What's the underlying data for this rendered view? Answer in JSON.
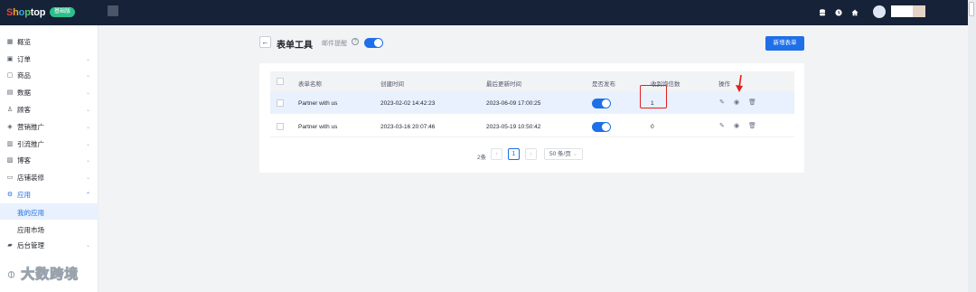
{
  "topbar": {
    "logo": {
      "s": "S",
      "h": "h",
      "o1": "o",
      "p": "p",
      "t": "t",
      "o2": "o",
      "p2": "p"
    },
    "plan_badge": "基础版",
    "icons": [
      "database-icon",
      "clock-icon",
      "home-icon"
    ]
  },
  "sidebar": {
    "items": [
      {
        "label": "概览",
        "icon": "▦"
      },
      {
        "label": "订单",
        "icon": "▣"
      },
      {
        "label": "商品",
        "icon": "▢"
      },
      {
        "label": "数据",
        "icon": "▤"
      },
      {
        "label": "顾客",
        "icon": "♙"
      },
      {
        "label": "营销推广",
        "icon": "◈"
      },
      {
        "label": "引流推广",
        "icon": "▥"
      },
      {
        "label": "博客",
        "icon": "▧"
      },
      {
        "label": "店铺装修",
        "icon": "▭"
      },
      {
        "label": "应用",
        "icon": "⚙"
      },
      {
        "label": "我的应用"
      },
      {
        "label": "应用市场"
      },
      {
        "label": "后台管理",
        "icon": "▰"
      }
    ]
  },
  "header": {
    "back": "←",
    "title": "表单工具",
    "email_label": "邮件提醒",
    "help": "?",
    "new_form": "新增表单"
  },
  "table": {
    "columns": [
      "表单名称",
      "创建时间",
      "最后更新时间",
      "是否发布",
      "收到询信数",
      "操作"
    ],
    "rows": [
      {
        "name": "Partner with us",
        "created": "2023-02-02 14:42:23",
        "updated": "2023-06-09 17:00:25",
        "published": true,
        "inquiries": "1"
      },
      {
        "name": "Partner with us",
        "created": "2023-03-16 20:07:46",
        "updated": "2023-05-19 10:50:42",
        "published": true,
        "inquiries": "0"
      }
    ]
  },
  "pagination": {
    "total": "2条",
    "prev": "‹",
    "current": "1",
    "next": "›",
    "page_size": "50 条/页"
  },
  "watermark": "大数跨境",
  "colors": {
    "topbar": "#152238",
    "accent": "#1e6fe8",
    "highlight_row": "#e8f1fd",
    "annotation": "#e02020"
  }
}
